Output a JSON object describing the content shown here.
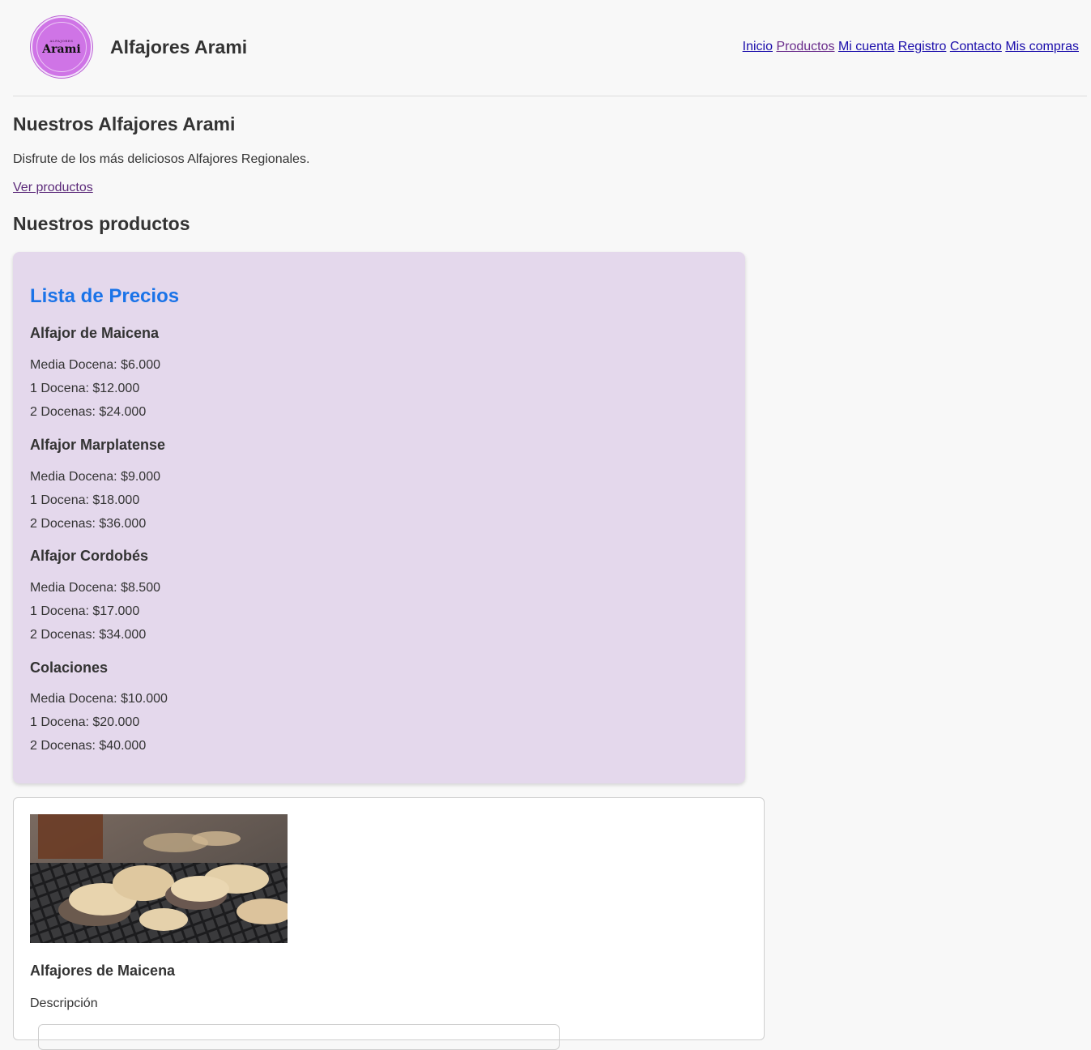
{
  "header": {
    "logo": {
      "small_text": "ALFAJORES",
      "text": "Arami"
    },
    "site_title": "Alfajores Arami",
    "nav": [
      {
        "label": "Inicio",
        "visited": false
      },
      {
        "label": "Productos",
        "visited": true
      },
      {
        "label": "Mi cuenta",
        "visited": false
      },
      {
        "label": "Registro",
        "visited": false
      },
      {
        "label": "Contacto",
        "visited": false
      },
      {
        "label": "Mis compras",
        "visited": false
      }
    ]
  },
  "hero": {
    "title": "Nuestros Alfajores Arami",
    "subtitle": "Disfrute de los más deliciosos Alfajores Regionales.",
    "link": "Ver productos"
  },
  "products_section": {
    "title": "Nuestros productos"
  },
  "price_list": {
    "title": "Lista de Precios",
    "products": [
      {
        "name": "Alfajor de Maicena",
        "prices": [
          "Media Docena: $6.000",
          "1 Docena: $12.000",
          "2 Docenas: $24.000"
        ]
      },
      {
        "name": "Alfajor Marplatense",
        "prices": [
          "Media Docena: $9.000",
          "1 Docena: $18.000",
          "2 Docenas: $36.000"
        ]
      },
      {
        "name": "Alfajor Cordobés",
        "prices": [
          "Media Docena: $8.500",
          "1 Docena: $17.000",
          "2 Docenas: $34.000"
        ]
      },
      {
        "name": "Colaciones",
        "prices": [
          "Media Docena: $10.000",
          "1 Docena: $20.000",
          "2 Docenas: $40.000"
        ]
      }
    ]
  },
  "product_card": {
    "image": "alfajores-photo",
    "title": "Alfajores de Maicena",
    "description_label": "Descripción"
  },
  "colors": {
    "background": "#f8f8f8",
    "price_card": "#e4d8ec",
    "price_title": "#1a73e8",
    "link": "#1a0dab",
    "visited_link": "#6a2d8c",
    "logo": "#cf74e6"
  }
}
